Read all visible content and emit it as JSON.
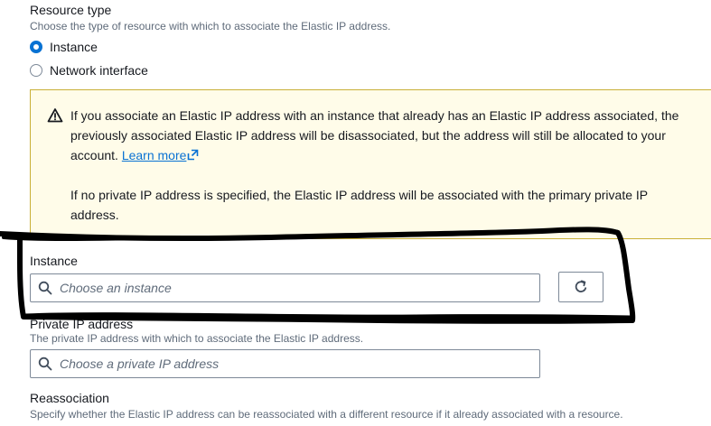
{
  "resource_type": {
    "label": "Resource type",
    "description": "Choose the type of resource with which to associate the Elastic IP address.",
    "options": [
      {
        "label": "Instance",
        "selected": true
      },
      {
        "label": "Network interface",
        "selected": false
      }
    ]
  },
  "warning": {
    "icon": "warning-triangle-icon",
    "paragraph1": "If you associate an Elastic IP address with an instance that already has an Elastic IP address associated, the previously associated Elastic IP address will be disassociated, but the address will still be allocated to your account.",
    "learn_more": "Learn more",
    "paragraph2": "If no private IP address is specified, the Elastic IP address will be associated with the primary private IP address."
  },
  "instance": {
    "label": "Instance",
    "placeholder": "Choose an instance",
    "refresh_icon": "refresh-icon"
  },
  "private_ip": {
    "label": "Private IP address",
    "description": "The private IP address with which to associate the Elastic IP address.",
    "placeholder": "Choose a private IP address"
  },
  "reassociation": {
    "label": "Reassociation",
    "description": "Specify whether the Elastic IP address can be reassociated with a different resource if it already associated with a resource."
  },
  "colors": {
    "accent": "#0972d3",
    "warning_background": "#fffce9",
    "warning_border": "#c9b037",
    "text": "#16191f",
    "secondary_text": "#5f6b7a"
  }
}
